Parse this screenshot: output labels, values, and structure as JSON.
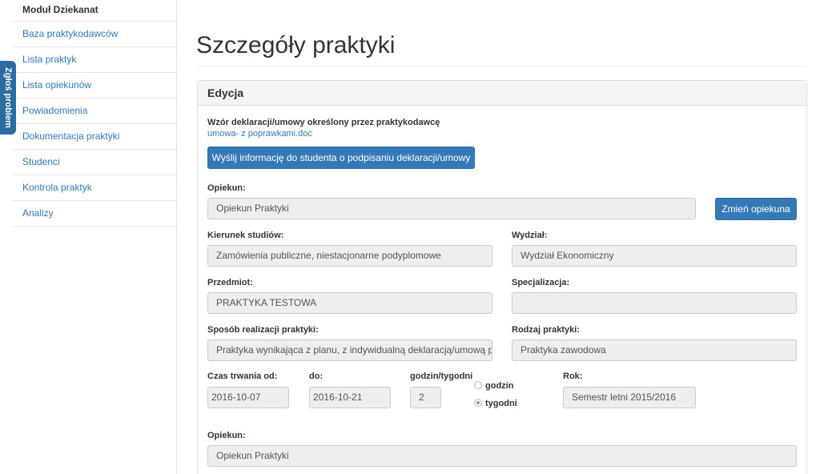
{
  "sidebar": {
    "title": "Moduł Dziekanat",
    "items": [
      {
        "label": "Baza praktykodawców"
      },
      {
        "label": "Lista praktyk"
      },
      {
        "label": "Lista opiekunów"
      },
      {
        "label": "Powiadomienia"
      },
      {
        "label": "Dokumentacja praktyki"
      },
      {
        "label": "Studenci"
      },
      {
        "label": "Kontrola praktyk"
      },
      {
        "label": "Analizy"
      }
    ]
  },
  "report_tab": {
    "label": "Zgłoś problem"
  },
  "page": {
    "title": "Szczegóły praktyki"
  },
  "panel": {
    "heading": "Edycja",
    "template_label": "Wzór deklaracji/umowy określony przez praktykodawcę",
    "template_link": "umowa- z poprawkami.doc",
    "send_button": "Wyślij informację do studenta o podpisaniu deklaracji/umowy",
    "supervisor": {
      "label": "Opiekun:",
      "value": "Opiekun Praktyki",
      "change_button": "Zmień opiekuna"
    },
    "direction": {
      "label": "Kierunek studiów:",
      "value": "Zamówienia publiczne, niestacjonarne podyplomowe"
    },
    "faculty": {
      "label": "Wydział:",
      "value": "Wydział Ekonomiczny"
    },
    "subject": {
      "label": "Przedmiot:",
      "value": "PRAKTYKA TESTOWA"
    },
    "specialization": {
      "label": "Specjalizacja:",
      "value": ""
    },
    "method": {
      "label": "Sposób realizacji praktyki:",
      "value": "Praktyka wynikająca z planu, z indywidualną deklaracją/umową p"
    },
    "type": {
      "label": "Rodzaj praktyki:",
      "value": "Praktyka zawodowa"
    },
    "duration_from": {
      "label": "Czas trwania od:",
      "value": "2016-10-07"
    },
    "duration_to": {
      "label": "do:",
      "value": "2016-10-21"
    },
    "hours": {
      "label": "godzin/tygodni",
      "value": "2",
      "options": [
        {
          "label": "godzin",
          "checked": false
        },
        {
          "label": "tygodni",
          "checked": true
        }
      ]
    },
    "year": {
      "label": "Rok:",
      "value": "Semestr letni 2015/2016"
    },
    "supervisor2": {
      "label": "Opiekun:",
      "value": "Opiekun Praktyki"
    }
  }
}
